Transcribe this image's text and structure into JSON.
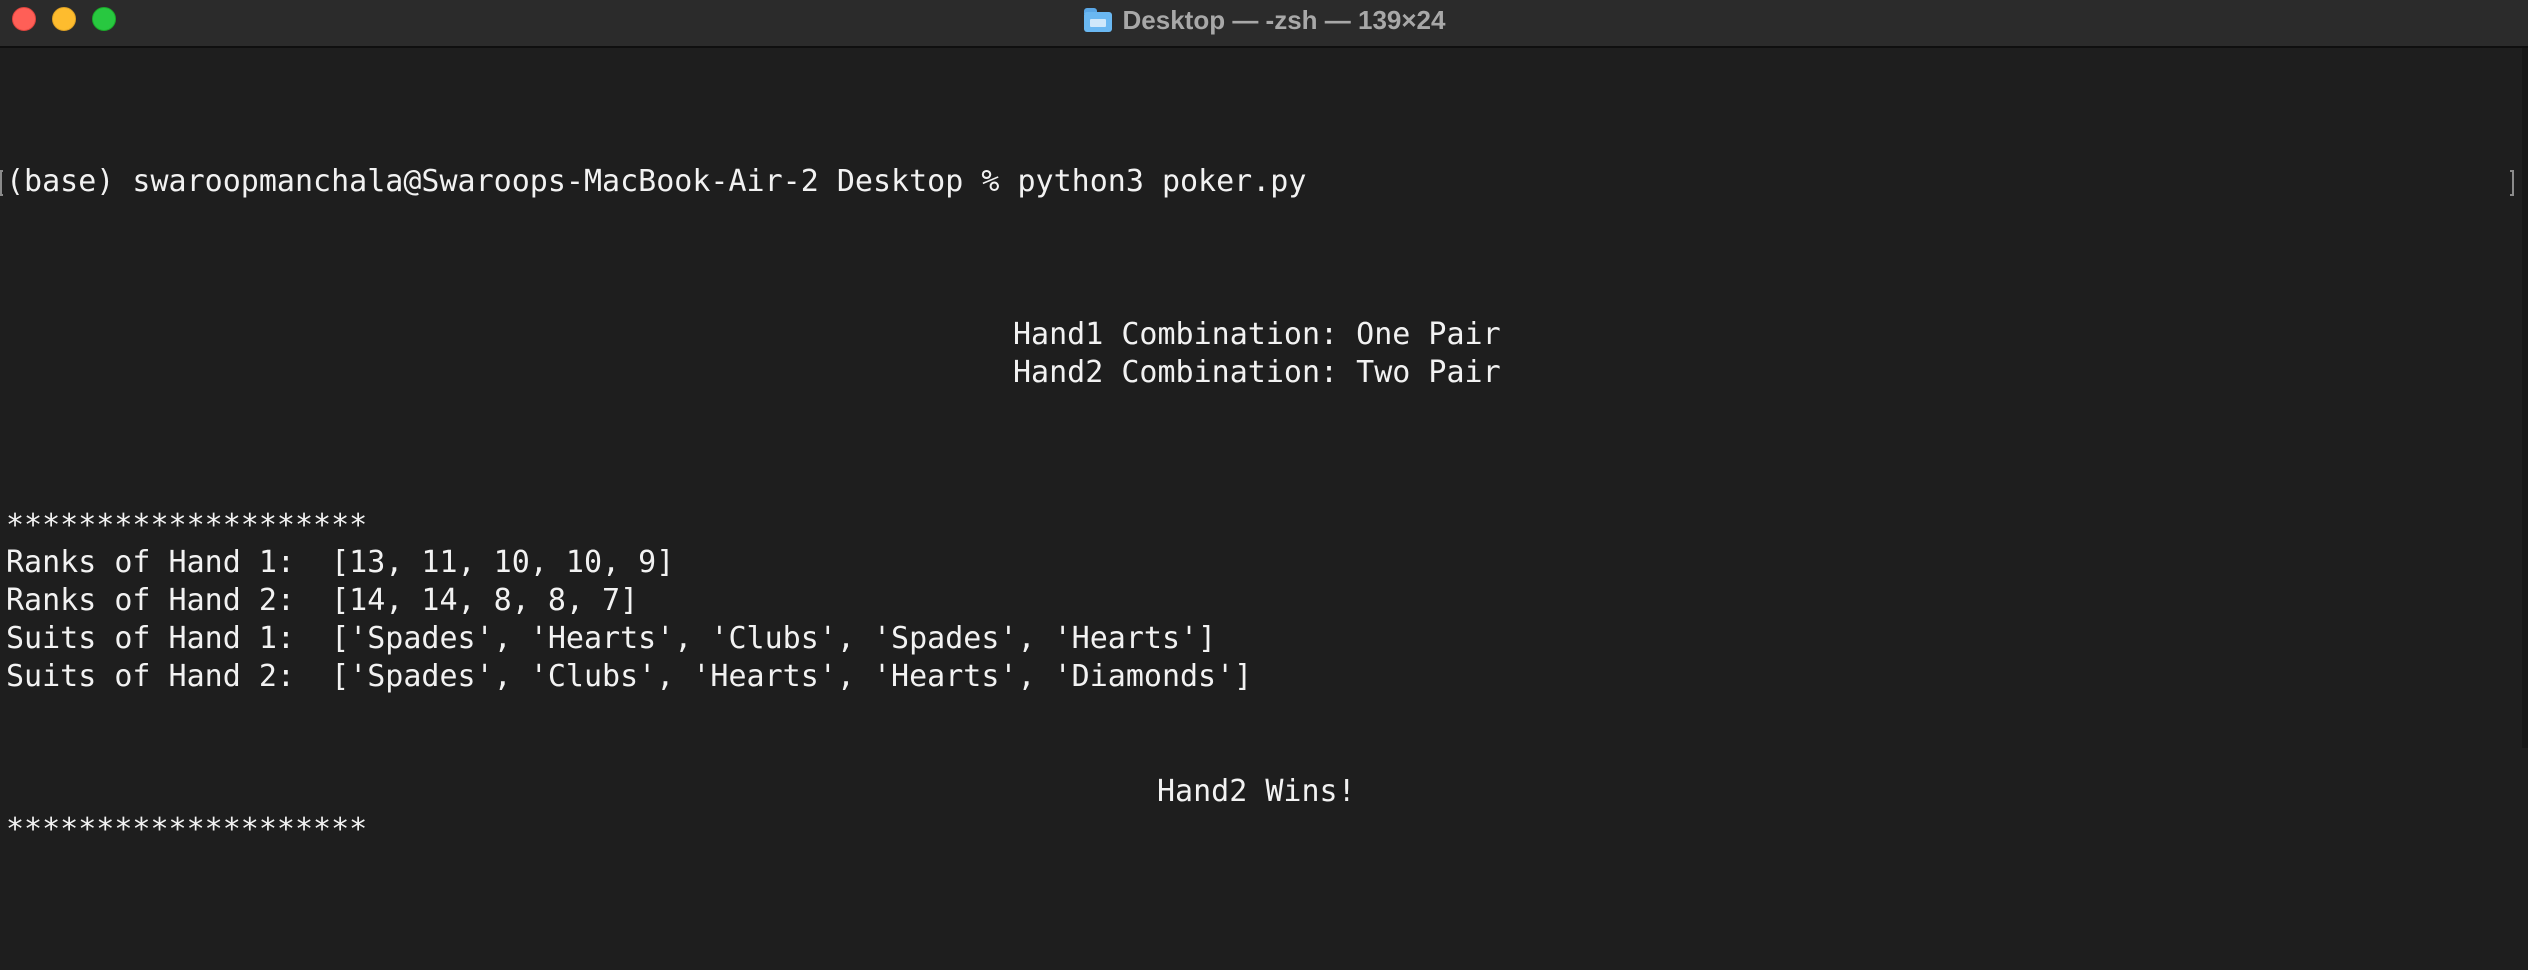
{
  "window": {
    "title": "Desktop — -zsh — 139×24",
    "title_icon": "folder-icon",
    "controls": [
      "close",
      "minimize",
      "zoom"
    ]
  },
  "terminal": {
    "prompt": "(base) swaroopmanchala@Swaroops-MacBook-Air-2 Desktop % python3 poker.py",
    "hand1_combination": "Hand1 Combination: One Pair",
    "hand2_combination": "Hand2 Combination: Two Pair",
    "separator_top": "********************",
    "ranks_hand1": "Ranks of Hand 1:  [13, 11, 10, 10, 9]",
    "ranks_hand2": "Ranks of Hand 2:  [14, 14, 8, 8, 7]",
    "suits_hand1": "Suits of Hand 1:  ['Spades', 'Hearts', 'Clubs', 'Spades', 'Hearts']",
    "suits_hand2": "Suits of Hand 2:  ['Spades', 'Clubs', 'Hearts', 'Hearts', 'Diamonds']",
    "result": "Hand2 Wins!",
    "separator_bottom": "********************"
  },
  "colors": {
    "background": "#1e1e1e",
    "titlebar": "#2b2b2b",
    "text": "#f2f2f2",
    "title_text": "#a8a8a8",
    "close": "#ff5f57",
    "minimize": "#febc2e",
    "zoom": "#28c840"
  }
}
